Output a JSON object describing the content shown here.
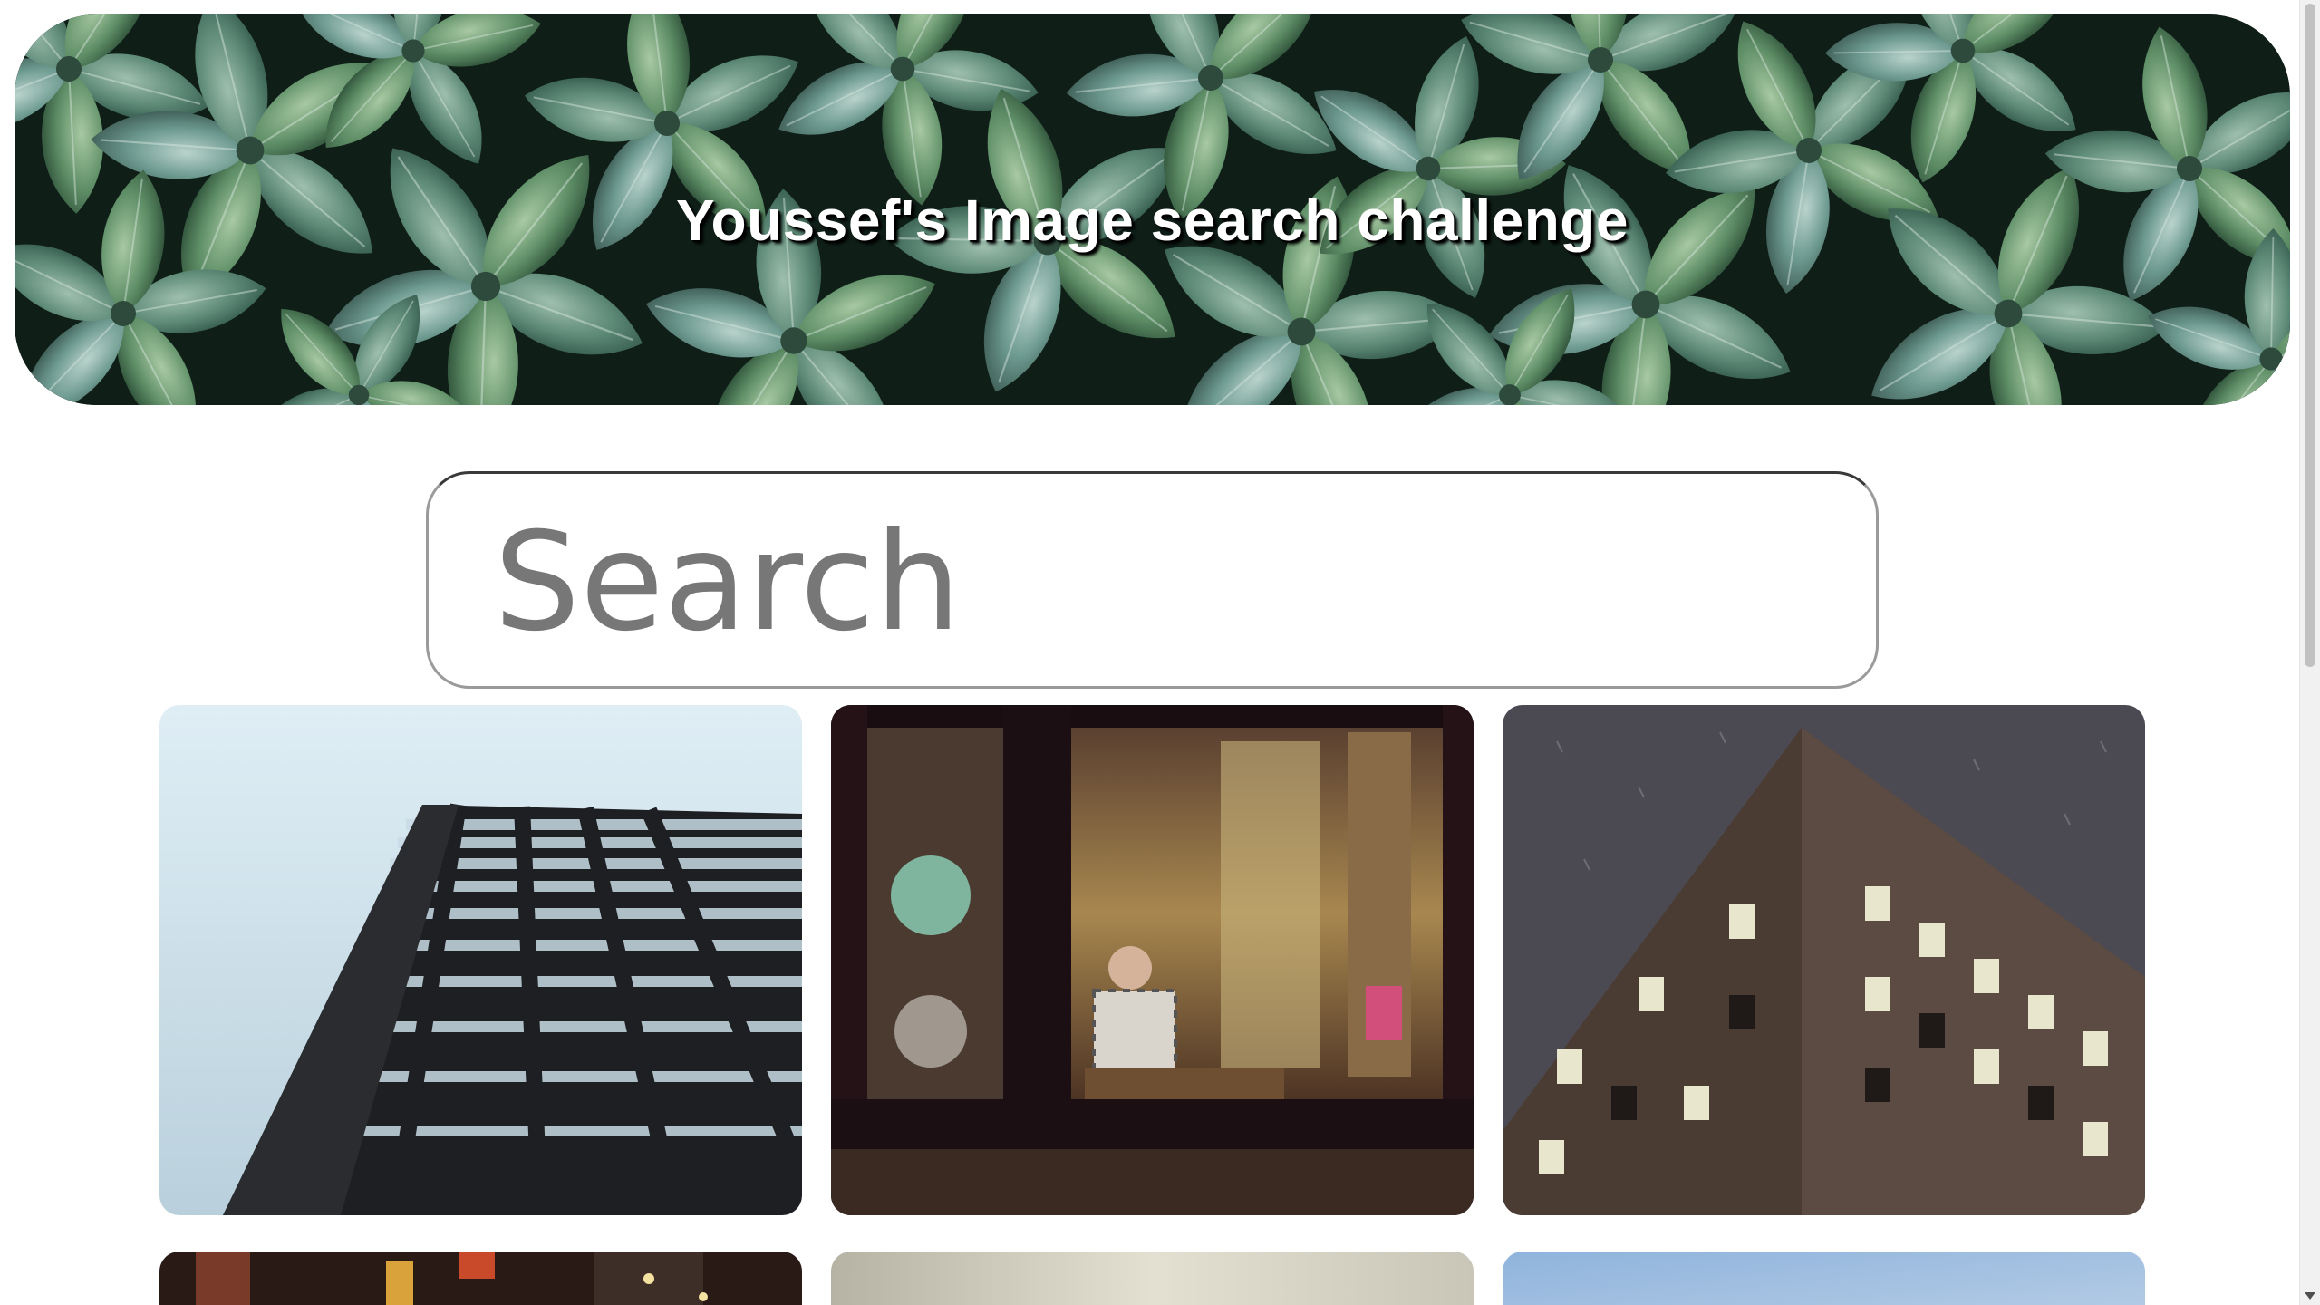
{
  "hero": {
    "title": "Youssef's Image search challenge",
    "image": "green-leaves-background"
  },
  "search": {
    "placeholder": "Search",
    "value": ""
  },
  "gallery": {
    "images": [
      {
        "subject": "glass-skyscraper-looking-up"
      },
      {
        "subject": "man-in-restaurant-through-window"
      },
      {
        "subject": "brick-building-corner-snow"
      },
      {
        "subject": "city-street-night"
      },
      {
        "subject": "hazy-city-skyline"
      },
      {
        "subject": "blue-sky-building"
      }
    ]
  },
  "colors": {
    "page_background": "#ffffff",
    "search_border": "#9a9a9a",
    "placeholder": "#777777",
    "title_text": "#ffffff"
  }
}
